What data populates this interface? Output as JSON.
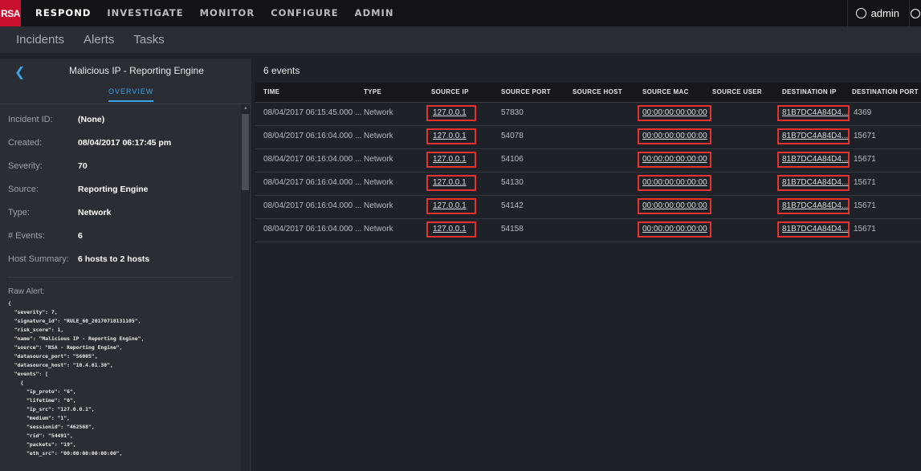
{
  "topnav": {
    "logo": "RSA",
    "items": [
      "RESPOND",
      "INVESTIGATE",
      "MONITOR",
      "CONFIGURE",
      "ADMIN"
    ],
    "active": "RESPOND",
    "user": "admin"
  },
  "subnav": {
    "items": [
      "Incidents",
      "Alerts",
      "Tasks"
    ]
  },
  "left": {
    "title": "Malicious IP - Reporting Engine",
    "tab": "OVERVIEW",
    "fields": [
      {
        "label": "Incident ID:",
        "value": "(None)"
      },
      {
        "label": "Created:",
        "value": "08/04/2017 06:17:45 pm"
      },
      {
        "label": "Severity:",
        "value": "70"
      },
      {
        "label": "Source:",
        "value": "Reporting Engine"
      },
      {
        "label": "Type:",
        "value": "Network"
      },
      {
        "label": "# Events:",
        "value": "6"
      },
      {
        "label": "Host Summary:",
        "value": "6 hosts to 2 hosts"
      }
    ],
    "raw_label": "Raw Alert:",
    "raw_json": "{\n  \"severity\": 7,\n  \"signature_id\": \"RULE_60_20170718131105\",\n  \"risk_score\": 1,\n  \"name\": \"Malicious IP - Reporting Engine\",\n  \"source\": \"RSA - Reporting Engine\",\n  \"datasource_port\": \"56005\",\n  \"datasource_host\": \"10.4.61.30\",\n  \"events\": [\n    {\n      \"ip_proto\": \"6\",\n      \"lifetime\": \"0\",\n      \"ip_src\": \"127.0.0.1\",\n      \"medium\": \"1\",\n      \"sessionid\": \"462568\",\n      \"rid\": \"54491\",\n      \"packets\": \"19\",\n      \"eth_src\": \"00:00:00:00:00:00\","
  },
  "main": {
    "count": "6 events",
    "columns": [
      "TIME",
      "TYPE",
      "SOURCE IP",
      "SOURCE PORT",
      "SOURCE HOST",
      "SOURCE MAC",
      "SOURCE USER",
      "DESTINATION IP",
      "DESTINATION PORT"
    ],
    "rows": [
      {
        "time": "08/04/2017 06:15:45.000 ...",
        "type": "Network",
        "src_ip": "127.0.0.1",
        "src_port": "57830",
        "src_mac": "00:00:00:00:00:00",
        "dst_ip": "81B7DC4A84D4...",
        "dst_port": "4369"
      },
      {
        "time": "08/04/2017 06:16:04.000 ...",
        "type": "Network",
        "src_ip": "127.0.0.1",
        "src_port": "54078",
        "src_mac": "00:00:00:00:00:00",
        "dst_ip": "81B7DC4A84D4...",
        "dst_port": "15671"
      },
      {
        "time": "08/04/2017 06:16:04.000 ...",
        "type": "Network",
        "src_ip": "127.0.0.1",
        "src_port": "54106",
        "src_mac": "00:00:00:00:00:00",
        "dst_ip": "81B7DC4A84D4...",
        "dst_port": "15671"
      },
      {
        "time": "08/04/2017 06:16:04.000 ...",
        "type": "Network",
        "src_ip": "127.0.0.1",
        "src_port": "54130",
        "src_mac": "00:00:00:00:00:00",
        "dst_ip": "81B7DC4A84D4...",
        "dst_port": "15671"
      },
      {
        "time": "08/04/2017 06:16:04.000 ...",
        "type": "Network",
        "src_ip": "127.0.0.1",
        "src_port": "54142",
        "src_mac": "00:00:00:00:00:00",
        "dst_ip": "81B7DC4A84D4...",
        "dst_port": "15671"
      },
      {
        "time": "08/04/2017 06:16:04.000 ...",
        "type": "Network",
        "src_ip": "127.0.0.1",
        "src_port": "54158",
        "src_mac": "00:00:00:00:00:00",
        "dst_ip": "81B7DC4A84D4...",
        "dst_port": "15671"
      }
    ]
  },
  "colors": {
    "accent": "#3aa3e3",
    "highlight": "#e2332e",
    "brand": "#c8102e"
  }
}
